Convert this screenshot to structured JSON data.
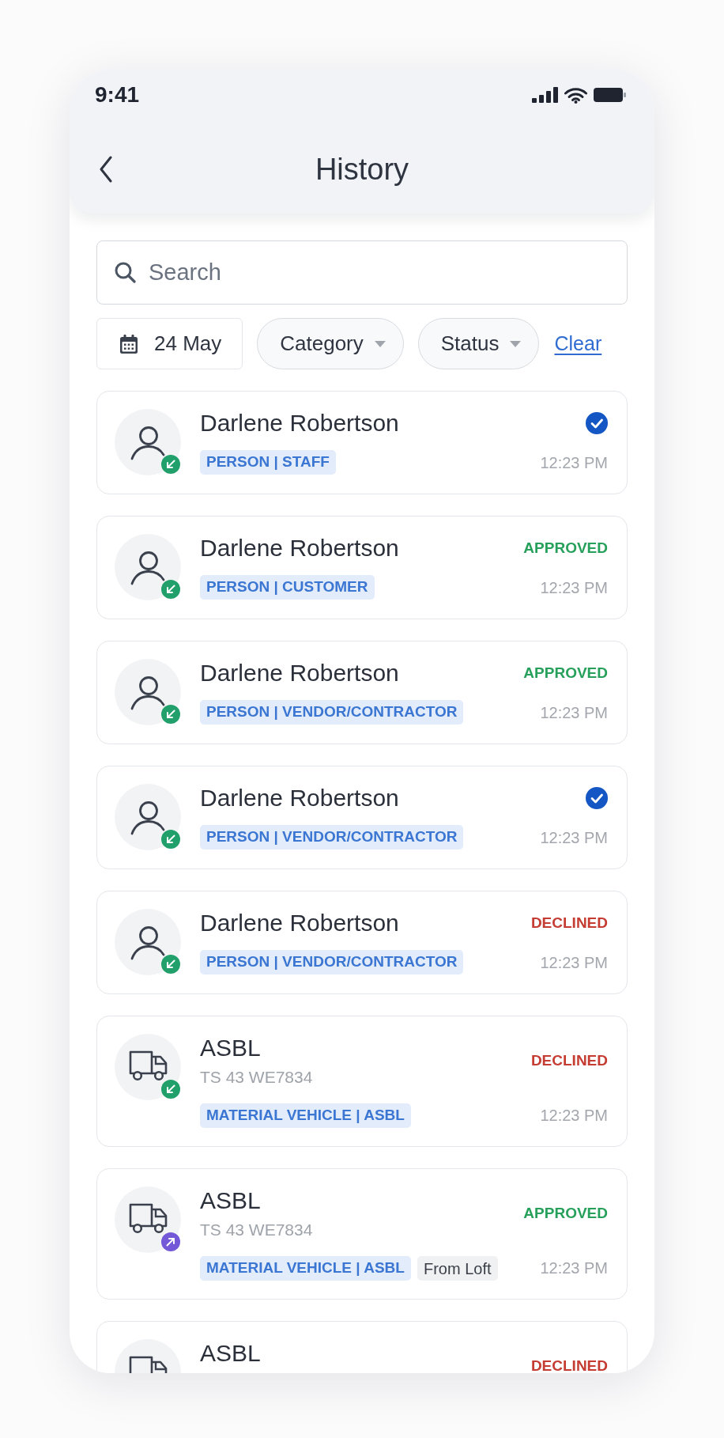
{
  "status_bar": {
    "time": "9:41"
  },
  "header": {
    "title": "History"
  },
  "search": {
    "placeholder": "Search"
  },
  "filters": [
    {
      "kind": "date",
      "label": "24 May"
    },
    {
      "kind": "dropdown",
      "label": "Category"
    },
    {
      "kind": "dropdown",
      "label": "Status"
    }
  ],
  "clear_link": "Clear",
  "entries": [
    {
      "kind": "person",
      "incoming": true,
      "name": "Darlene Robertson",
      "tags": [
        {
          "kind": "category",
          "label": "PERSON | STAFF"
        }
      ],
      "status": {
        "kind": "verified"
      },
      "time": "12:23 PM"
    },
    {
      "kind": "person",
      "incoming": true,
      "name": "Darlene Robertson",
      "tags": [
        {
          "kind": "category",
          "label": "PERSON | CUSTOMER"
        }
      ],
      "status": {
        "kind": "approved",
        "label": "APPROVED"
      },
      "time": "12:23 PM"
    },
    {
      "kind": "person",
      "incoming": true,
      "name": "Darlene Robertson",
      "tags": [
        {
          "kind": "category",
          "label": "PERSON | VENDOR/CONTRACTOR"
        }
      ],
      "status": {
        "kind": "approved",
        "label": "APPROVED"
      },
      "time": "12:23 PM"
    },
    {
      "kind": "person",
      "incoming": true,
      "name": "Darlene Robertson",
      "tags": [
        {
          "kind": "category",
          "label": "PERSON | VENDOR/CONTRACTOR"
        }
      ],
      "status": {
        "kind": "verified"
      },
      "time": "12:23 PM"
    },
    {
      "kind": "person",
      "incoming": true,
      "name": "Darlene Robertson",
      "tags": [
        {
          "kind": "category",
          "label": "PERSON | VENDOR/CONTRACTOR"
        }
      ],
      "status": {
        "kind": "declined",
        "label": "DECLINED"
      },
      "time": "12:23 PM"
    },
    {
      "kind": "vehicle",
      "incoming": true,
      "name": "ASBL",
      "plate": "TS 43 WE7834",
      "tags": [
        {
          "kind": "category",
          "label": "MATERIAL VEHICLE | ASBL"
        }
      ],
      "status": {
        "kind": "declined",
        "label": "DECLINED"
      },
      "time": "12:23 PM"
    },
    {
      "kind": "vehicle",
      "incoming": false,
      "name": "ASBL",
      "plate": "TS 43 WE7834",
      "tags": [
        {
          "kind": "category",
          "label": "MATERIAL VEHICLE | ASBL"
        },
        {
          "kind": "note",
          "label": "From Loft"
        }
      ],
      "status": {
        "kind": "approved",
        "label": "APPROVED"
      },
      "time": "12:23 PM"
    },
    {
      "kind": "vehicle",
      "name": "ASBL",
      "status": {
        "kind": "declined",
        "label": "DECLINED"
      }
    }
  ]
}
